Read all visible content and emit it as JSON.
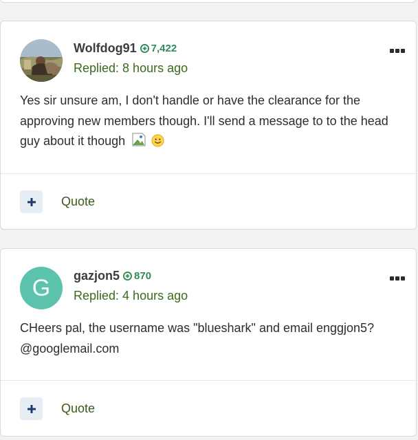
{
  "posts": [
    {
      "username": "Wolfdog91",
      "reputation": "7,422",
      "replied": "Replied: 8 hours ago",
      "body": "Yes sir unsure am, I don't handle or have the clearance for the approving new members though. I'll send a message to to the head guy about it though",
      "quote_label": "Quote"
    },
    {
      "username": "gazjon5",
      "avatar_letter": "G",
      "avatar_color": "#5cc3ad",
      "reputation": "870",
      "replied": "Replied: 4 hours ago",
      "body": "CHeers pal, the username was \"blueshark\" and email enggjon5?@googlemail.com",
      "quote_label": "Quote"
    }
  ],
  "colors": {
    "accent_green": "#2e8b57",
    "reply_green": "#3a6a1c",
    "action_bg": "#e6edf4",
    "action_icon": "#1f3a6b"
  }
}
